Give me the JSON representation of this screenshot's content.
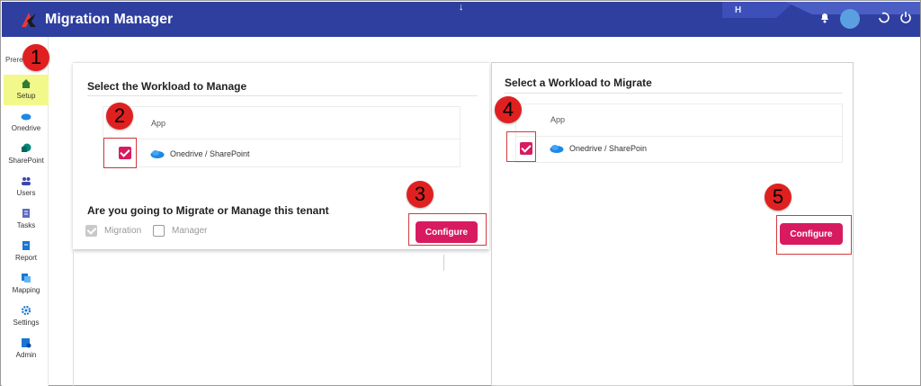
{
  "window": {
    "title": "Migration Manager",
    "top_arrow": "↓",
    "tab_hint": "H"
  },
  "sidebar": {
    "prereq_label": "Prere",
    "items": [
      {
        "label": "Setup",
        "icon": "home-icon",
        "active": true
      },
      {
        "label": "Onedrive",
        "icon": "cloud-icon"
      },
      {
        "label": "SharePoint",
        "icon": "sharepoint-icon"
      },
      {
        "label": "Users",
        "icon": "users-icon"
      },
      {
        "label": "Tasks",
        "icon": "tasks-icon"
      },
      {
        "label": "Report",
        "icon": "report-icon"
      },
      {
        "label": "Mapping",
        "icon": "mapping-icon"
      },
      {
        "label": "Settings",
        "icon": "gear-icon"
      },
      {
        "label": "Admin",
        "icon": "admin-icon"
      }
    ]
  },
  "left_panel": {
    "title": "Select the Workload to Manage",
    "table_header": "App",
    "row_name": "Onedrive / SharePoint",
    "question": "Are you going to Migrate or Manage this tenant",
    "option_migration": "Migration",
    "option_manager": "Manager",
    "configure_label": "Configure"
  },
  "right_panel": {
    "title": "Select a Workload to Migrate",
    "table_header": "App",
    "row_name": "Onedrive / SharePoin",
    "configure_label": "Configure"
  },
  "callouts": {
    "n1": "1",
    "n2": "2",
    "n3": "3",
    "n4": "4",
    "n5": "5"
  },
  "colors": {
    "titlebar": "#2f3fa0",
    "accent": "#d81b60",
    "callout": "#e02020",
    "active_nav": "#f2f88a"
  }
}
